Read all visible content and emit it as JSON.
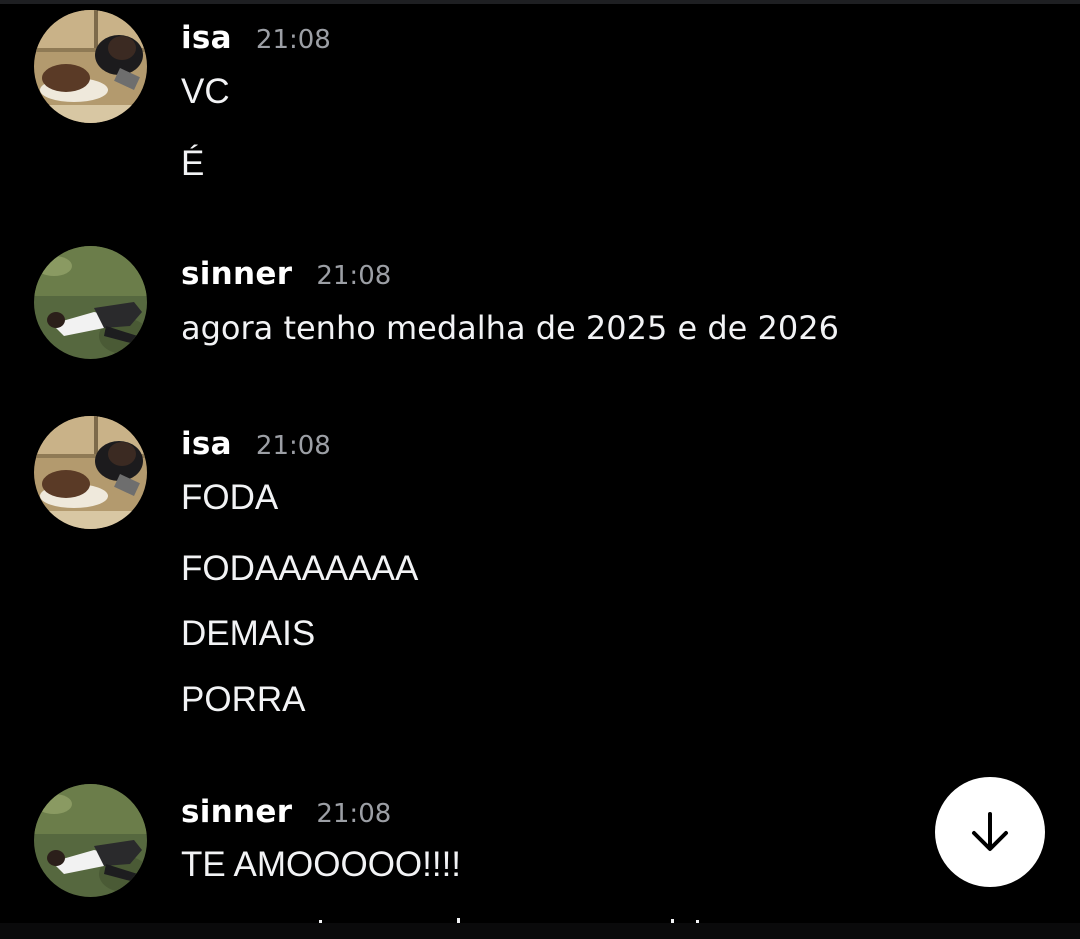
{
  "messages": [
    {
      "author": "isa",
      "time": "21:08",
      "avatar": "isa-avatar",
      "lines": [
        "VC",
        "É"
      ]
    },
    {
      "author": "sinner",
      "time": "21:08",
      "avatar": "sinner-avatar",
      "lines": [
        "agora tenho medalha de 2025 e de 2026"
      ]
    },
    {
      "author": "isa",
      "time": "21:08",
      "avatar": "isa-avatar",
      "lines": [
        "FODA",
        "FODAAAAAAA",
        "DEMAIS",
        "PORRA"
      ]
    },
    {
      "author": "sinner",
      "time": "21:08",
      "avatar": "sinner-avatar",
      "lines": [
        "TE AMOOOOO!!!!"
      ]
    }
  ],
  "scroll_button": {
    "icon": "arrow-down-icon"
  },
  "colors": {
    "background": "#000000",
    "text": "#f2f3f5",
    "username": "#ffffff",
    "timestamp": "#9c9fa5",
    "scroll_button_bg": "#ffffff"
  }
}
